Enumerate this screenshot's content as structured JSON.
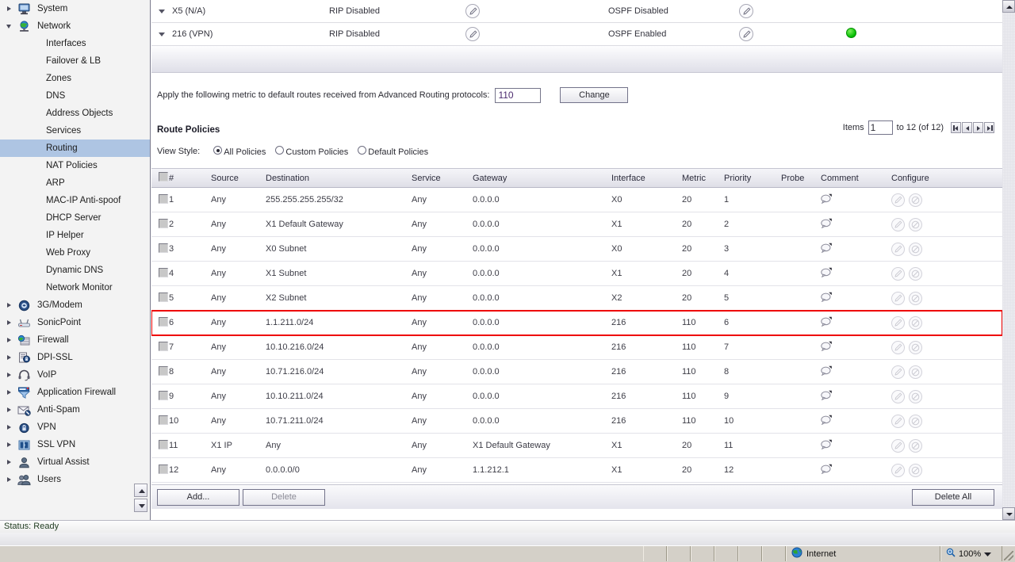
{
  "sidebar": {
    "items": [
      {
        "label": "System",
        "level": "top",
        "icon": "monitor-icon",
        "expander": "right",
        "selected": false
      },
      {
        "label": "Network",
        "level": "top",
        "icon": "globe-network-icon",
        "expander": "down",
        "selected": false
      },
      {
        "label": "Interfaces",
        "level": "child",
        "icon": "",
        "expander": "",
        "selected": false
      },
      {
        "label": "Failover & LB",
        "level": "child",
        "icon": "",
        "expander": "",
        "selected": false
      },
      {
        "label": "Zones",
        "level": "child",
        "icon": "",
        "expander": "",
        "selected": false
      },
      {
        "label": "DNS",
        "level": "child",
        "icon": "",
        "expander": "",
        "selected": false
      },
      {
        "label": "Address Objects",
        "level": "child",
        "icon": "",
        "expander": "",
        "selected": false
      },
      {
        "label": "Services",
        "level": "child",
        "icon": "",
        "expander": "",
        "selected": false
      },
      {
        "label": "Routing",
        "level": "child",
        "icon": "",
        "expander": "",
        "selected": true
      },
      {
        "label": "NAT Policies",
        "level": "child",
        "icon": "",
        "expander": "",
        "selected": false
      },
      {
        "label": "ARP",
        "level": "child",
        "icon": "",
        "expander": "",
        "selected": false
      },
      {
        "label": "MAC-IP Anti-spoof",
        "level": "child",
        "icon": "",
        "expander": "",
        "selected": false
      },
      {
        "label": "DHCP Server",
        "level": "child",
        "icon": "",
        "expander": "",
        "selected": false
      },
      {
        "label": "IP Helper",
        "level": "child",
        "icon": "",
        "expander": "",
        "selected": false
      },
      {
        "label": "Web Proxy",
        "level": "child",
        "icon": "",
        "expander": "",
        "selected": false
      },
      {
        "label": "Dynamic DNS",
        "level": "child",
        "icon": "",
        "expander": "",
        "selected": false
      },
      {
        "label": "Network Monitor",
        "level": "child",
        "icon": "",
        "expander": "",
        "selected": false
      },
      {
        "label": "3G/Modem",
        "level": "top",
        "icon": "modem-icon",
        "expander": "right",
        "selected": false
      },
      {
        "label": "SonicPoint",
        "level": "top",
        "icon": "access-point-icon",
        "expander": "right",
        "selected": false
      },
      {
        "label": "Firewall",
        "level": "top",
        "icon": "firewall-icon",
        "expander": "right",
        "selected": false
      },
      {
        "label": "DPI-SSL",
        "level": "top",
        "icon": "lock-document-icon",
        "expander": "right",
        "selected": false
      },
      {
        "label": "VoIP",
        "level": "top",
        "icon": "headset-icon",
        "expander": "right",
        "selected": false
      },
      {
        "label": "Application Firewall",
        "level": "top",
        "icon": "funnel-icon",
        "expander": "right",
        "selected": false
      },
      {
        "label": "Anti-Spam",
        "level": "top",
        "icon": "envelope-block-icon",
        "expander": "right",
        "selected": false
      },
      {
        "label": "VPN",
        "level": "top",
        "icon": "padlock-icon",
        "expander": "right",
        "selected": false
      },
      {
        "label": "SSL VPN",
        "level": "top",
        "icon": "ssl-vpn-icon",
        "expander": "right",
        "selected": false
      },
      {
        "label": "Virtual Assist",
        "level": "top",
        "icon": "user-icon",
        "expander": "right",
        "selected": false
      },
      {
        "label": "Users",
        "level": "top",
        "icon": "users-icon",
        "expander": "right",
        "selected": false
      }
    ]
  },
  "protocol_rows": [
    {
      "interface": "X5 (N/A)",
      "rip_status": "RIP Disabled",
      "ospf_status": "OSPF Disabled",
      "has_indicator": false
    },
    {
      "interface": "216 (VPN)",
      "rip_status": "RIP Disabled",
      "ospf_status": "OSPF Enabled",
      "has_indicator": true
    }
  ],
  "metric_bar": {
    "label": "Apply the following metric to default routes received from Advanced Routing protocols:",
    "value": "110",
    "change_label": "Change"
  },
  "route_policies": {
    "title": "Route Policies",
    "pager": {
      "items_label": "Items",
      "start": "1",
      "range_label": "to 12 (of 12)"
    },
    "view_style": {
      "label": "View Style:",
      "options": [
        {
          "label": "All Policies",
          "selected": true
        },
        {
          "label": "Custom Policies",
          "selected": false
        },
        {
          "label": "Default Policies",
          "selected": false
        }
      ]
    },
    "columns": [
      "#",
      "Source",
      "Destination",
      "Service",
      "Gateway",
      "Interface",
      "Metric",
      "Priority",
      "Probe",
      "Comment",
      "Configure"
    ],
    "rows": [
      {
        "num": "1",
        "source": "Any",
        "destination": "255.255.255.255/32",
        "service": "Any",
        "gateway": "0.0.0.0",
        "interface": "X0",
        "metric": "20",
        "priority": "1",
        "probe": "",
        "highlight": false
      },
      {
        "num": "2",
        "source": "Any",
        "destination": "X1 Default Gateway",
        "service": "Any",
        "gateway": "0.0.0.0",
        "interface": "X1",
        "metric": "20",
        "priority": "2",
        "probe": "",
        "highlight": false
      },
      {
        "num": "3",
        "source": "Any",
        "destination": "X0 Subnet",
        "service": "Any",
        "gateway": "0.0.0.0",
        "interface": "X0",
        "metric": "20",
        "priority": "3",
        "probe": "",
        "highlight": false
      },
      {
        "num": "4",
        "source": "Any",
        "destination": "X1 Subnet",
        "service": "Any",
        "gateway": "0.0.0.0",
        "interface": "X1",
        "metric": "20",
        "priority": "4",
        "probe": "",
        "highlight": false
      },
      {
        "num": "5",
        "source": "Any",
        "destination": "X2 Subnet",
        "service": "Any",
        "gateway": "0.0.0.0",
        "interface": "X2",
        "metric": "20",
        "priority": "5",
        "probe": "",
        "highlight": false
      },
      {
        "num": "6",
        "source": "Any",
        "destination": "1.1.211.0/24",
        "service": "Any",
        "gateway": "0.0.0.0",
        "interface": "216",
        "metric": "110",
        "priority": "6",
        "probe": "",
        "highlight": true
      },
      {
        "num": "7",
        "source": "Any",
        "destination": "10.10.216.0/24",
        "service": "Any",
        "gateway": "0.0.0.0",
        "interface": "216",
        "metric": "110",
        "priority": "7",
        "probe": "",
        "highlight": false
      },
      {
        "num": "8",
        "source": "Any",
        "destination": "10.71.216.0/24",
        "service": "Any",
        "gateway": "0.0.0.0",
        "interface": "216",
        "metric": "110",
        "priority": "8",
        "probe": "",
        "highlight": false
      },
      {
        "num": "9",
        "source": "Any",
        "destination": "10.10.211.0/24",
        "service": "Any",
        "gateway": "0.0.0.0",
        "interface": "216",
        "metric": "110",
        "priority": "9",
        "probe": "",
        "highlight": false
      },
      {
        "num": "10",
        "source": "Any",
        "destination": "10.71.211.0/24",
        "service": "Any",
        "gateway": "0.0.0.0",
        "interface": "216",
        "metric": "110",
        "priority": "10",
        "probe": "",
        "highlight": false
      },
      {
        "num": "11",
        "source": "X1 IP",
        "destination": "Any",
        "service": "Any",
        "gateway": "X1 Default Gateway",
        "interface": "X1",
        "metric": "20",
        "priority": "11",
        "probe": "",
        "highlight": false
      },
      {
        "num": "12",
        "source": "Any",
        "destination": "0.0.0.0/0",
        "service": "Any",
        "gateway": "1.1.212.1",
        "interface": "X1",
        "metric": "20",
        "priority": "12",
        "probe": "",
        "highlight": false
      }
    ],
    "footer": {
      "add_label": "Add...",
      "delete_label": "Delete",
      "delete_all_label": "Delete All"
    }
  },
  "status": {
    "text": "Status: Ready"
  },
  "browser_bar": {
    "zone_label": "Internet",
    "zoom_label": "100%"
  },
  "colors": {
    "selection": "#aec5e3",
    "highlight_outline": "#ee0000",
    "status_green": "#00bb00",
    "input_text": "#4b2a6e"
  }
}
